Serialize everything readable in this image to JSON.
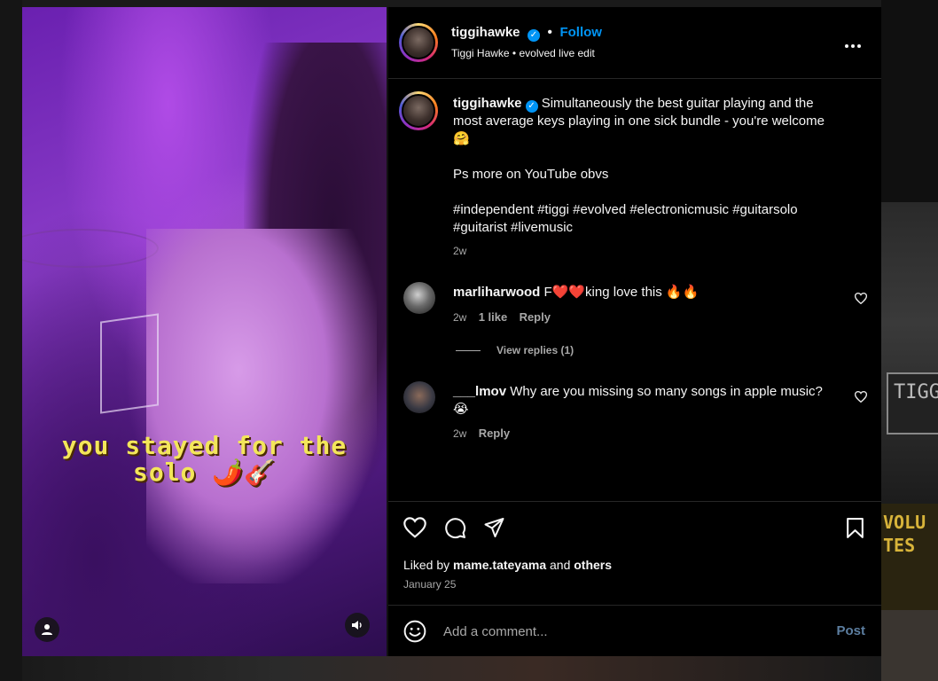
{
  "media": {
    "caption_overlay_line1": "you stayed for the",
    "caption_overlay_line2": "solo 🌶️🎸"
  },
  "post_header": {
    "username": "tiggihawke",
    "follow_label": "Follow",
    "subtitle_name": "Tiggi Hawke",
    "subtitle_audio": "evolved live edit",
    "separator": "•"
  },
  "caption": {
    "username": "tiggihawke",
    "text_line1": "Simultaneously the best guitar playing and the",
    "text_line2": "most average keys playing in one sick bundle - you're welcome",
    "text_emoji": "🤗",
    "ps": "Ps more on YouTube obvs",
    "hashtags_line1": "#independent #tiggi #evolved #electronicmusic #guitarsolo",
    "hashtags_line2": "#guitarist #livemusic",
    "time": "2w"
  },
  "comments": [
    {
      "username": "marliharwood",
      "text": "F❤️❤️king love this 🔥🔥",
      "time": "2w",
      "likes": "1 like",
      "reply_label": "Reply",
      "view_replies": "View replies (1)"
    },
    {
      "username": "___lmov",
      "text": "Why are you missing so many songs in apple music?",
      "emoji": "😭",
      "time": "2w",
      "reply_label": "Reply"
    }
  ],
  "likes": {
    "prefix": "Liked by",
    "user": "mame.tateyama",
    "and": "and",
    "others": "others",
    "date": "January 25"
  },
  "add_comment": {
    "placeholder": "Add a comment...",
    "post_label": "Post"
  },
  "background": {
    "sign_text": "TIGG",
    "poster_text_1": "VOLU",
    "poster_text_2": "TES"
  },
  "colors": {
    "accent": "#0095f6",
    "muted": "#a8a8a8",
    "overlay_text": "#f3e65a"
  }
}
